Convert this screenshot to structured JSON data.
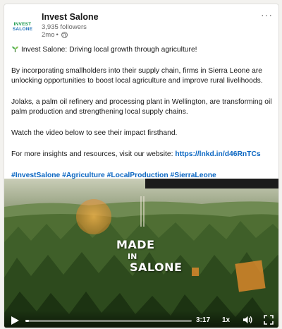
{
  "post": {
    "org_name": "Invest Salone",
    "logo": {
      "line1": "INVEST",
      "line2": "SALONE"
    },
    "followers": "3,935 followers",
    "time": "2mo",
    "separator": "•",
    "visibility_icon": "globe-icon",
    "more_icon": "ellipsis-icon",
    "more_label": "···",
    "paragraphs": {
      "intro": "Invest Salone: Driving local growth through agriculture!",
      "p2_line1": "By incorporating smallholders into their supply chain, firms in Sierra Leone are",
      "p2_line2": "unlocking opportunities to boost local agriculture and improve rural livelihoods.",
      "p3_line1": "Jolaks, a palm oil refinery and processing plant in Wellington, are transforming oil",
      "p3_line2": "palm production and strengthening local supply chains.",
      "p4": "Watch the video below to see their impact firsthand.",
      "p5_prefix": "For more insights and resources, visit our website: ",
      "p5_link": "https://lnkd.in/d46RnTCs"
    },
    "hashtags": [
      "#InvestSalone",
      "#Agriculture",
      "#LocalProduction",
      "#SierraLeone"
    ]
  },
  "video": {
    "overlay_line1": "MADE",
    "overlay_line2": "IN",
    "overlay_line3": "SALONE",
    "time_remaining": "3:17",
    "speed": "1x",
    "progress": 0.02
  },
  "colors": {
    "link": "#0a66c2",
    "logo_green": "#1a9a4c",
    "logo_blue": "#1d6fb8"
  }
}
